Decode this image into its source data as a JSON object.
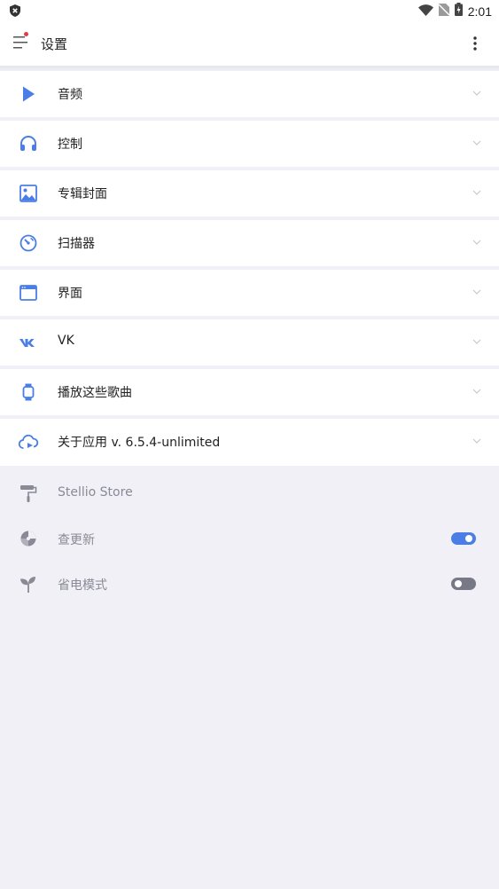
{
  "status_bar": {
    "time": "2:01"
  },
  "app_bar": {
    "title": "设置"
  },
  "settings": [
    {
      "label": "音频",
      "icon": "play-icon"
    },
    {
      "label": "控制",
      "icon": "headphones-icon"
    },
    {
      "label": "专辑封面",
      "icon": "image-icon"
    },
    {
      "label": "扫描器",
      "icon": "gauge-icon"
    },
    {
      "label": "界面",
      "icon": "window-icon"
    },
    {
      "label": "VK",
      "icon": "vk-icon"
    },
    {
      "label": "播放这些歌曲",
      "icon": "smartwatch-icon"
    },
    {
      "label": "关于应用 v. 6.5.4-unlimited",
      "icon": "info-cloud-icon"
    }
  ],
  "extras": {
    "store": {
      "label": "Stellio Store",
      "icon": "paint-roller-icon"
    },
    "updates": {
      "label": "查更新",
      "icon": "update-icon",
      "enabled": true
    },
    "power_saving": {
      "label": "省电模式",
      "icon": "leaf-icon",
      "enabled": false
    }
  },
  "colors": {
    "accent": "#4a7ee6",
    "background": "#f0f0f6",
    "toggle_off": "#777a86"
  }
}
